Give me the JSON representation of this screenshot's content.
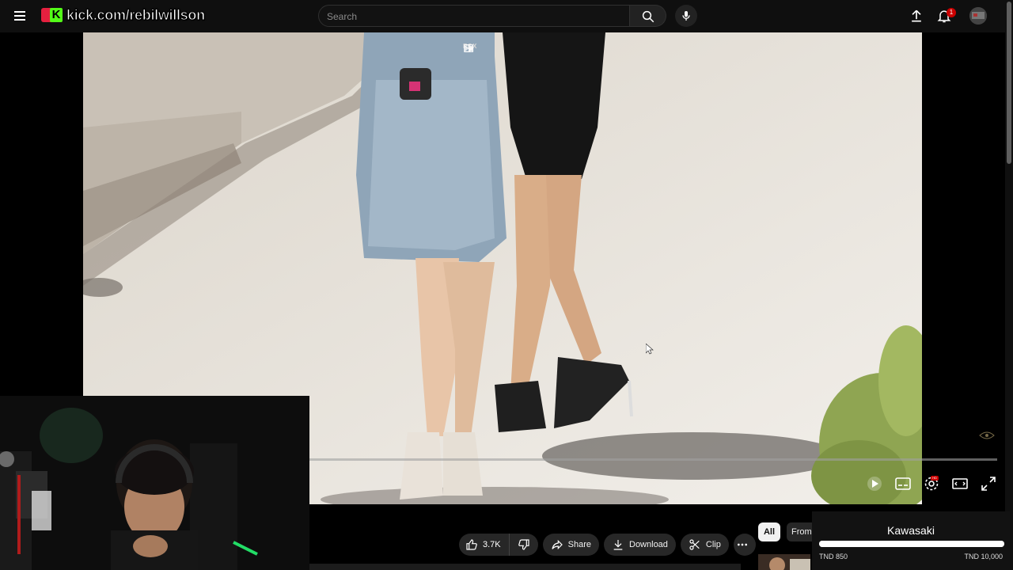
{
  "header": {
    "brand_text": "kick.com/rebilwillson",
    "brand_k": "K",
    "search_placeholder": "Search",
    "notification_count": "1"
  },
  "video": {
    "mini_controls_label": "RGX",
    "hd_badge": "HD"
  },
  "actions": {
    "like_count": "3.7K",
    "share_label": "Share",
    "download_label": "Download",
    "clip_label": "Clip"
  },
  "chips": {
    "all_label": "All",
    "from_label": "From"
  },
  "goal": {
    "title": "Kawasaki",
    "current": "TND 850",
    "target": "TND 10,000",
    "progress": 1.0
  },
  "icons": [
    "menu-icon",
    "search-icon",
    "mic-icon",
    "upload-icon",
    "bell-icon",
    "like-icon",
    "dislike-icon",
    "share-icon",
    "download-icon",
    "clip-icon",
    "more-icon",
    "settings-icon",
    "subtitles-icon",
    "theater-icon",
    "fullscreen-icon",
    "play-icon"
  ],
  "colors": {
    "kick_green": "#53fc18",
    "youtube_red": "#cc0000",
    "bg": "#0f0f0f"
  }
}
